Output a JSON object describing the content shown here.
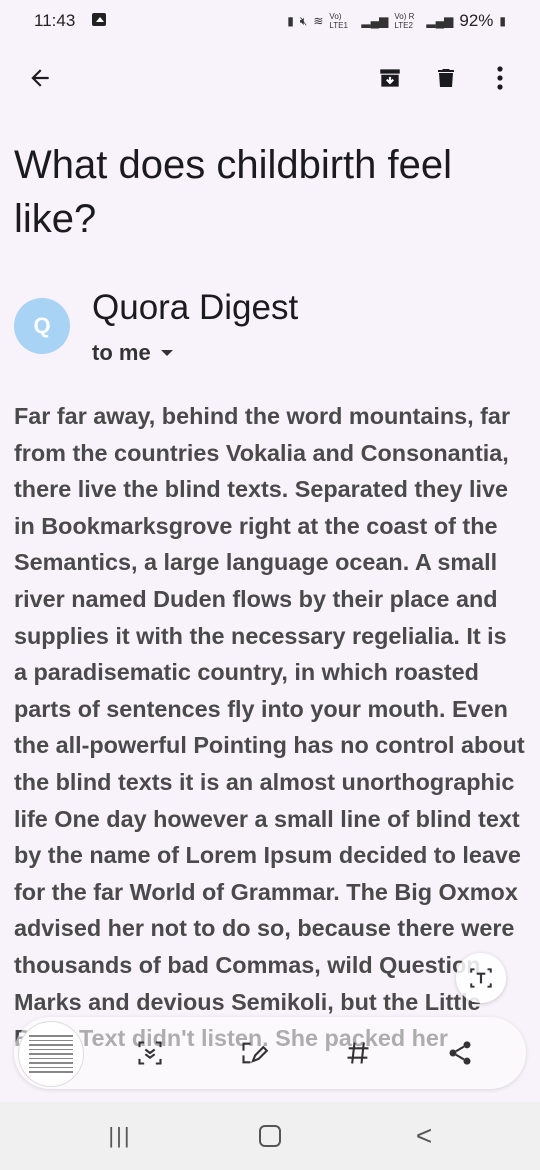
{
  "status_bar": {
    "time": "11:43",
    "line1": "Vo) LTE1",
    "line2": "Vo) R LTE2",
    "battery": "92%"
  },
  "icons": {
    "back": "arrow-back-icon",
    "archive": "archive-icon",
    "delete": "trash-icon",
    "more": "more-vert-icon",
    "text_extract": "text-scan-icon",
    "scan": "scan-icon",
    "edit": "edit-frame-icon",
    "hashtag": "hashtag-icon",
    "share": "share-icon"
  },
  "email": {
    "subject": "What does childbirth feel like?",
    "avatar_letter": "Q",
    "avatar_color": "#a8d3f5",
    "sender": "Quora Digest",
    "recipient": "to me",
    "body": "Far far away, behind the word mountains, far from the countries Vokalia and Consonantia, there live the blind texts. Separated they live in Bookmarksgrove right at the coast of the Semantics, a large language ocean. A small river named Duden flows by their place and supplies it with the necessary regelialia. It is a paradisematic country, in which roasted parts of sentences fly into your mouth. Even the all-powerful Pointing has no control about the blind texts it is an almost unorthographic life One day however a small line of blind text by the name of Lorem Ipsum decided to leave for the far World of Grammar. The Big Oxmox advised her not to do so, because there were thousands of bad Commas, wild Question Marks and devious Semikoli, but the Little Blind Text didn't listen. She packed her"
  },
  "nav_bar": {
    "recents": "|||",
    "back": "<"
  },
  "colors": {
    "background": "#f8f2fa",
    "text": "#1b1b1f",
    "body_text": "#4a4a4a"
  }
}
